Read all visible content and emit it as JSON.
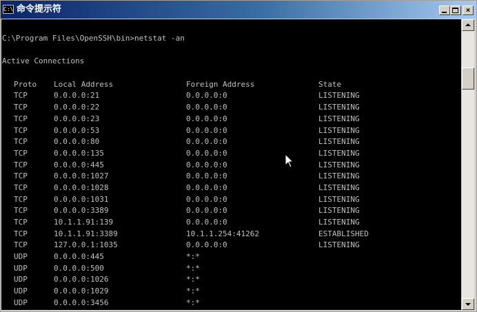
{
  "window": {
    "icon_label": "C:\\",
    "title": "命令提示符",
    "minimize_label": "_",
    "maximize_label": "□",
    "close_label": "×"
  },
  "console": {
    "command_line": "C:\\Program Files\\OpenSSH\\bin>netstat -an",
    "section_title": "Active Connections",
    "headers": {
      "proto": "Proto",
      "local": "Local Address",
      "foreign": "Foreign Address",
      "state": "State"
    },
    "rows": [
      {
        "proto": "TCP",
        "local": "0.0.0.0:21",
        "foreign": "0.0.0.0:0",
        "state": "LISTENING"
      },
      {
        "proto": "TCP",
        "local": "0.0.0.0:22",
        "foreign": "0.0.0.0:0",
        "state": "LISTENING"
      },
      {
        "proto": "TCP",
        "local": "0.0.0.0:23",
        "foreign": "0.0.0.0:0",
        "state": "LISTENING"
      },
      {
        "proto": "TCP",
        "local": "0.0.0.0:53",
        "foreign": "0.0.0.0:0",
        "state": "LISTENING"
      },
      {
        "proto": "TCP",
        "local": "0.0.0.0:80",
        "foreign": "0.0.0.0:0",
        "state": "LISTENING"
      },
      {
        "proto": "TCP",
        "local": "0.0.0.0:135",
        "foreign": "0.0.0.0:0",
        "state": "LISTENING"
      },
      {
        "proto": "TCP",
        "local": "0.0.0.0:445",
        "foreign": "0.0.0.0:0",
        "state": "LISTENING"
      },
      {
        "proto": "TCP",
        "local": "0.0.0.0:1027",
        "foreign": "0.0.0.0:0",
        "state": "LISTENING"
      },
      {
        "proto": "TCP",
        "local": "0.0.0.0:1028",
        "foreign": "0.0.0.0:0",
        "state": "LISTENING"
      },
      {
        "proto": "TCP",
        "local": "0.0.0.0:1031",
        "foreign": "0.0.0.0:0",
        "state": "LISTENING"
      },
      {
        "proto": "TCP",
        "local": "0.0.0.0:3389",
        "foreign": "0.0.0.0:0",
        "state": "LISTENING"
      },
      {
        "proto": "TCP",
        "local": "10.1.1.91:139",
        "foreign": "0.0.0.0:0",
        "state": "LISTENING"
      },
      {
        "proto": "TCP",
        "local": "10.1.1.91:3389",
        "foreign": "10.1.1.254:41262",
        "state": "ESTABLISHED"
      },
      {
        "proto": "TCP",
        "local": "127.0.0.1:1035",
        "foreign": "0.0.0.0:0",
        "state": "LISTENING"
      },
      {
        "proto": "UDP",
        "local": "0.0.0.0:445",
        "foreign": "*:*",
        "state": ""
      },
      {
        "proto": "UDP",
        "local": "0.0.0.0:500",
        "foreign": "*:*",
        "state": ""
      },
      {
        "proto": "UDP",
        "local": "0.0.0.0:1026",
        "foreign": "*:*",
        "state": ""
      },
      {
        "proto": "UDP",
        "local": "0.0.0.0:1029",
        "foreign": "*:*",
        "state": ""
      },
      {
        "proto": "UDP",
        "local": "0.0.0.0:3456",
        "foreign": "*:*",
        "state": ""
      }
    ]
  },
  "colors": {
    "console_bg": "#000000",
    "console_text": "#c0c0c0",
    "title_active": "#0a246a"
  },
  "icons": [
    "console-app-icon",
    "minimize-icon",
    "maximize-icon",
    "close-icon",
    "scroll-up-icon",
    "scroll-down-icon",
    "mouse-pointer-icon"
  ]
}
